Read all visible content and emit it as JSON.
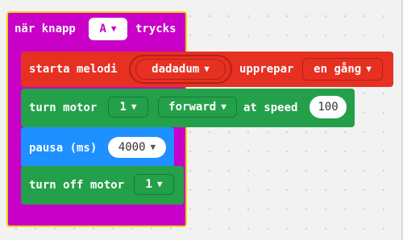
{
  "colors": {
    "event_block": "#c800c8",
    "music_block": "#e63022",
    "motor_block": "#24a04b",
    "basic_block": "#1e90ff"
  },
  "event_block": {
    "label": "när knapp",
    "button_value": "A",
    "suffix": "trycks"
  },
  "melody_block": {
    "label": "starta melodi",
    "melody_value": "dadadum",
    "repeat_label": "upprepar",
    "repeat_value": "en gång"
  },
  "motor_block": {
    "label": "turn motor",
    "motor_value": "1",
    "direction_value": "forward",
    "speed_label": "at speed",
    "speed_value": "100"
  },
  "pause_block": {
    "label": "pausa (ms)",
    "duration_value": "4000"
  },
  "motor_off_block": {
    "label": "turn off motor",
    "motor_value": "1"
  },
  "icons": {
    "dropdown": "caret-down-icon"
  }
}
